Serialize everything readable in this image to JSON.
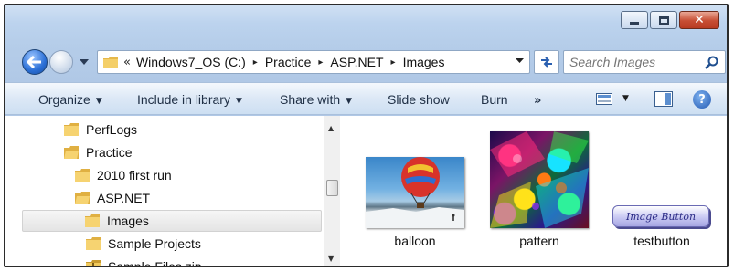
{
  "window": {
    "caption_buttons": {
      "minimize": "minimize",
      "maximize": "maximize",
      "close": "close"
    }
  },
  "nav": {
    "breadcrumb_lead": "«",
    "breadcrumb": [
      "Windows7_OS (C:)",
      "Practice",
      "ASP.NET",
      "Images"
    ],
    "separator": "▸",
    "search_placeholder": "Search Images"
  },
  "toolbar": {
    "organize": "Organize",
    "include_in_library": "Include in library",
    "share_with": "Share with",
    "slide_show": "Slide show",
    "burn": "Burn",
    "more": "»",
    "help": "?"
  },
  "tree": [
    {
      "label": "PerfLogs",
      "selected": false
    },
    {
      "label": "Practice",
      "selected": false
    },
    {
      "label": "2010 first run",
      "selected": false
    },
    {
      "label": "ASP.NET",
      "selected": false
    },
    {
      "label": "Images",
      "selected": true
    },
    {
      "label": "Sample Projects",
      "selected": false
    },
    {
      "label": "Sample Files.zip",
      "selected": false
    }
  ],
  "files": [
    {
      "name": "balloon"
    },
    {
      "name": "pattern"
    },
    {
      "name": "testbutton",
      "preview_text": "Image Button"
    }
  ],
  "colors": {
    "window_chrome": "#bcd3ee",
    "selection": "#e4e4e4",
    "close_button": "#c74d33",
    "accent_blue": "#2a6fd6"
  }
}
